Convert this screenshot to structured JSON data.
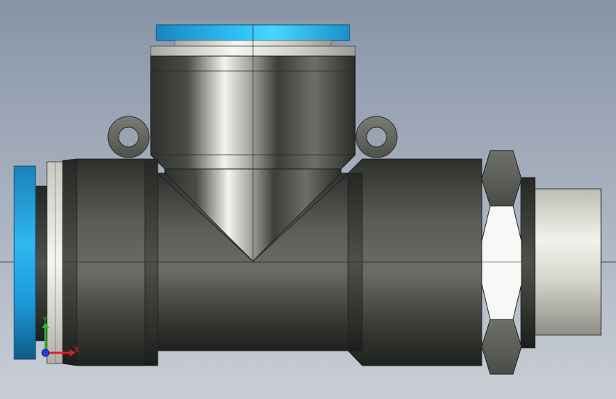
{
  "viewport": {
    "background_top": "#8894a6",
    "background_bottom": "#c9ced6"
  },
  "model": {
    "component": "tee-fitting",
    "colors": {
      "body_dark": "#2c2f2d",
      "body_mid": "#6a6d68",
      "body_light": "#e8e8e2",
      "push_ring": "#2fb8f0",
      "release_collar": "#f2f2ee",
      "hex_nut": "#5a5c56",
      "tube_stub": "#d8d8d0"
    }
  },
  "triad": {
    "x_label": "X",
    "y_label": "Y",
    "x_color": "#e02020",
    "y_color": "#20c020",
    "z_color": "#2040e0"
  }
}
